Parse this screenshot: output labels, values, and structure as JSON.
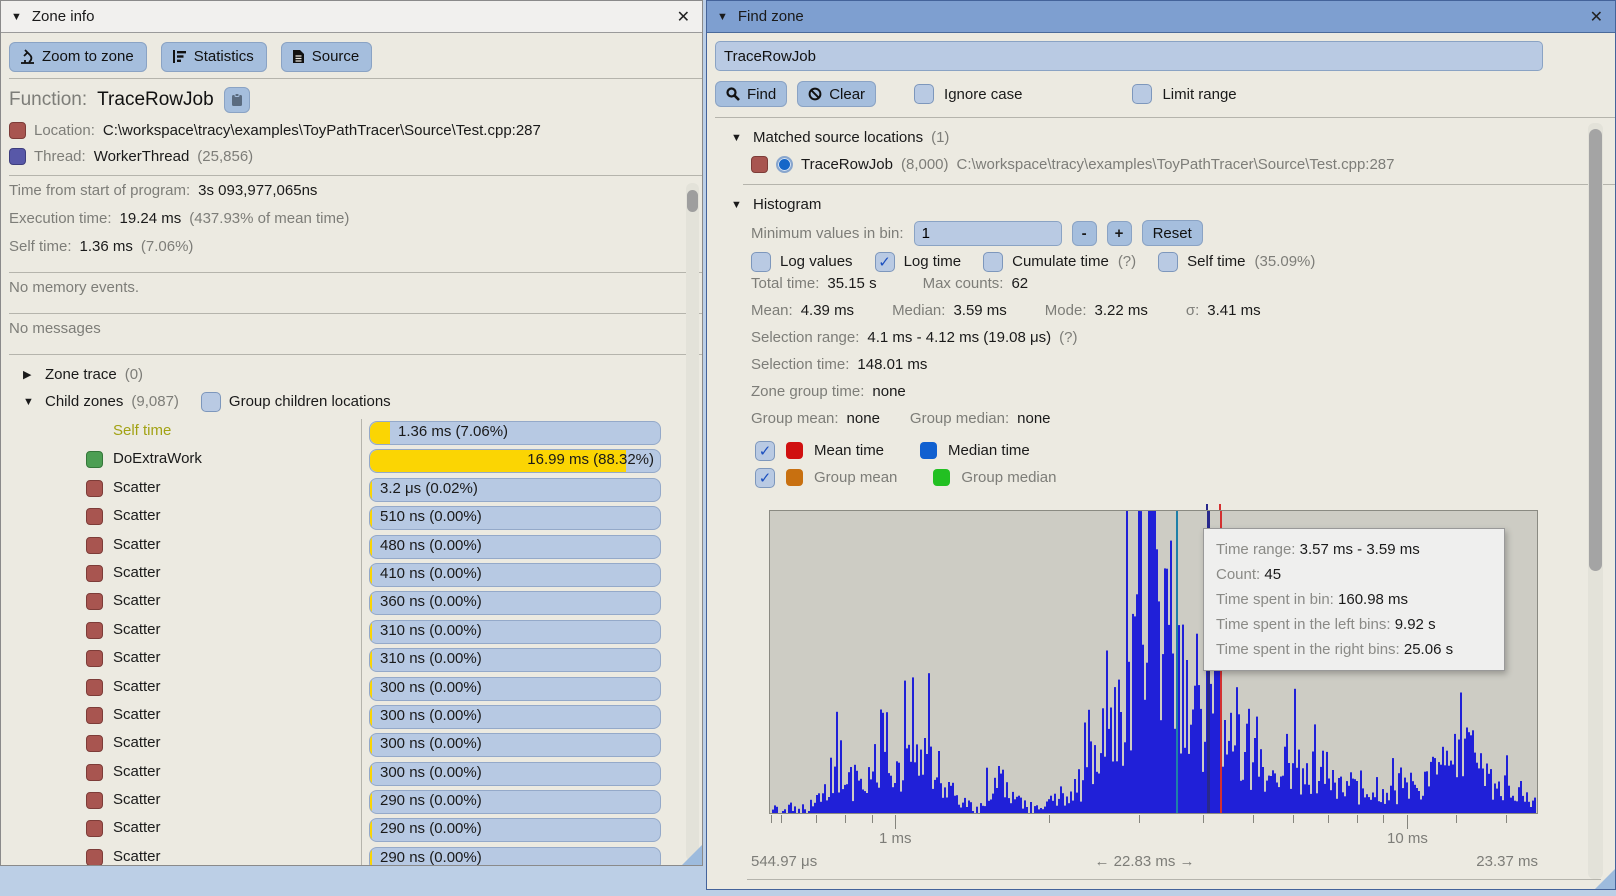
{
  "zone_info": {
    "title": "Zone info",
    "collapse_icon": "▼",
    "close_icon": "✕",
    "toolbar": {
      "zoom_label": "Zoom to zone",
      "stats_label": "Statistics",
      "source_label": "Source"
    },
    "function_label": "Function:",
    "function_name": "TraceRowJob",
    "location_label": "Location:",
    "location_path": "C:\\workspace\\tracy\\examples\\ToyPathTracer\\Source\\Test.cpp:287",
    "thread_label": "Thread:",
    "thread_name": "WorkerThread",
    "thread_id": "(25,856)",
    "time_from_start_label": "Time from start of program:",
    "time_from_start": "3s 093,977,065ns",
    "execution_time_label": "Execution time:",
    "execution_time": "19.24 ms",
    "execution_time_note": "(437.93% of mean time)",
    "self_time_label": "Self time:",
    "self_time": "1.36 ms",
    "self_time_note": "(7.06%)",
    "no_memory_events": "No memory events.",
    "no_messages": "No messages",
    "zone_trace_label": "Zone trace",
    "zone_trace_count": "(0)",
    "child_zones_label": "Child zones",
    "child_zones_count": "(9,087)",
    "group_children_label": "Group children locations",
    "child_rows": [
      {
        "swatch": "none",
        "name": "Self time",
        "value": "1.36 ms (7.06%)",
        "pct": 7.06
      },
      {
        "swatch": "green",
        "name": "DoExtraWork",
        "value": "16.99 ms (88.32%)",
        "pct": 88.32
      },
      {
        "swatch": "red",
        "name": "Scatter",
        "value": "3.2 μs (0.02%)",
        "pct": 0.7
      },
      {
        "swatch": "red",
        "name": "Scatter",
        "value": "510 ns (0.00%)",
        "pct": 0.7
      },
      {
        "swatch": "red",
        "name": "Scatter",
        "value": "480 ns (0.00%)",
        "pct": 0.7
      },
      {
        "swatch": "red",
        "name": "Scatter",
        "value": "410 ns (0.00%)",
        "pct": 0.7
      },
      {
        "swatch": "red",
        "name": "Scatter",
        "value": "360 ns (0.00%)",
        "pct": 0.7
      },
      {
        "swatch": "red",
        "name": "Scatter",
        "value": "310 ns (0.00%)",
        "pct": 0.7
      },
      {
        "swatch": "red",
        "name": "Scatter",
        "value": "310 ns (0.00%)",
        "pct": 0.7
      },
      {
        "swatch": "red",
        "name": "Scatter",
        "value": "300 ns (0.00%)",
        "pct": 0.7
      },
      {
        "swatch": "red",
        "name": "Scatter",
        "value": "300 ns (0.00%)",
        "pct": 0.7
      },
      {
        "swatch": "red",
        "name": "Scatter",
        "value": "300 ns (0.00%)",
        "pct": 0.7
      },
      {
        "swatch": "red",
        "name": "Scatter",
        "value": "300 ns (0.00%)",
        "pct": 0.7
      },
      {
        "swatch": "red",
        "name": "Scatter",
        "value": "290 ns (0.00%)",
        "pct": 0.7
      },
      {
        "swatch": "red",
        "name": "Scatter",
        "value": "290 ns (0.00%)",
        "pct": 0.7
      },
      {
        "swatch": "red",
        "name": "Scatter",
        "value": "290 ns (0.00%)",
        "pct": 0.7
      },
      {
        "swatch": "red",
        "name": "Scatter",
        "value": "290 ns (0.00%)",
        "pct": 0.7
      }
    ]
  },
  "find_zone": {
    "title": "Find zone",
    "collapse_icon": "▼",
    "close_icon": "✕",
    "search_value": "TraceRowJob",
    "find_label": "Find",
    "clear_label": "Clear",
    "ignore_case_label": "Ignore case",
    "limit_range_label": "Limit range",
    "matched_label": "Matched source locations",
    "matched_count": "(1)",
    "match": {
      "name": "TraceRowJob",
      "count": "(8,000)",
      "path": "C:\\workspace\\tracy\\examples\\ToyPathTracer\\Source\\Test.cpp:287"
    },
    "histogram_label": "Histogram",
    "min_values_label": "Minimum values in bin:",
    "min_values_value": "1",
    "minus_label": "-",
    "plus_label": "+",
    "reset_label": "Reset",
    "log_values_label": "Log values",
    "log_time_label": "Log time",
    "cumulate_label": "Cumulate time",
    "cumulate_help": "(?)",
    "self_time_label": "Self time",
    "self_time_note": "(35.09%)",
    "total_time_label": "Total time:",
    "total_time": "35.15 s",
    "max_counts_label": "Max counts:",
    "max_counts": "62",
    "mean_label": "Mean:",
    "mean": "4.39 ms",
    "median_label": "Median:",
    "median": "3.59 ms",
    "mode_label": "Mode:",
    "mode": "3.22 ms",
    "sigma_label": "σ:",
    "sigma": "3.41 ms",
    "selection_range_label": "Selection range:",
    "selection_range": "4.1 ms - 4.12 ms (19.08 μs)",
    "selection_range_help": "(?)",
    "selection_time_label": "Selection time:",
    "selection_time": "148.01 ms",
    "zone_group_time_label": "Zone group time:",
    "zone_group_time": "none",
    "group_mean_label": "Group mean:",
    "group_mean": "none",
    "group_median_label": "Group median:",
    "group_median": "none",
    "legend": {
      "mean_time": "Mean time",
      "median_time": "Median time",
      "group_mean": "Group mean",
      "group_median": "Group median"
    },
    "tooltip": {
      "time_range_label": "Time range:",
      "time_range": "3.57 ms - 3.59 ms",
      "count_label": "Count:",
      "count": "45",
      "bin_label": "Time spent in bin:",
      "bin": "160.98 ms",
      "left_label": "Time spent in the left bins:",
      "left": "9.92 s",
      "right_label": "Time spent in the right bins:",
      "right": "25.06 s"
    },
    "axis": {
      "major_labels": [
        "1 ms",
        "10 ms"
      ],
      "min_label": "544.97 μs",
      "center_label": "← 22.83 ms →",
      "max_label": "23.37 ms"
    },
    "chart_data": {
      "type": "bar",
      "title": "Zone execution time histogram (log time axis)",
      "x_min": "544.97 μs",
      "x_max": "23.37 ms",
      "y_max_counts": 62,
      "bar_color": "#2020d8",
      "mean_marker": {
        "value": "4.39 ms",
        "frac": 0.587,
        "color": "#d43030"
      },
      "median_marker": {
        "value": "3.59 ms",
        "frac": 0.529,
        "color": "#1e7fa8"
      },
      "selection_marker": {
        "value": "4.1 ms - 4.12 ms",
        "frac": 0.57,
        "color": "#28288c"
      },
      "envelope": [
        [
          0,
          0.02
        ],
        [
          0.05,
          0.03
        ],
        [
          0.07,
          0.1
        ],
        [
          0.085,
          0.3
        ],
        [
          0.1,
          0.12
        ],
        [
          0.13,
          0.2
        ],
        [
          0.155,
          0.32
        ],
        [
          0.175,
          0.22
        ],
        [
          0.19,
          0.3
        ],
        [
          0.21,
          0.26
        ],
        [
          0.225,
          0.12
        ],
        [
          0.25,
          0.05
        ],
        [
          0.27,
          0.02
        ],
        [
          0.3,
          0.17
        ],
        [
          0.315,
          0.06
        ],
        [
          0.34,
          0.03
        ],
        [
          0.37,
          0.06
        ],
        [
          0.4,
          0.12
        ],
        [
          0.42,
          0.2
        ],
        [
          0.44,
          0.35
        ],
        [
          0.46,
          0.55
        ],
        [
          0.47,
          0.75
        ],
        [
          0.48,
          1.0
        ],
        [
          0.49,
          0.9
        ],
        [
          0.5,
          0.95
        ],
        [
          0.51,
          0.8
        ],
        [
          0.52,
          0.85
        ],
        [
          0.53,
          0.7
        ],
        [
          0.55,
          0.6
        ],
        [
          0.57,
          0.5
        ],
        [
          0.59,
          0.45
        ],
        [
          0.61,
          0.35
        ],
        [
          0.63,
          0.28
        ],
        [
          0.65,
          0.22
        ],
        [
          0.67,
          0.25
        ],
        [
          0.69,
          0.18
        ],
        [
          0.71,
          0.22
        ],
        [
          0.73,
          0.16
        ],
        [
          0.75,
          0.12
        ],
        [
          0.77,
          0.1
        ],
        [
          0.79,
          0.08
        ],
        [
          0.81,
          0.1
        ],
        [
          0.83,
          0.15
        ],
        [
          0.85,
          0.12
        ],
        [
          0.87,
          0.18
        ],
        [
          0.89,
          0.22
        ],
        [
          0.905,
          0.3
        ],
        [
          0.92,
          0.18
        ],
        [
          0.94,
          0.14
        ],
        [
          0.96,
          0.16
        ],
        [
          0.98,
          0.08
        ],
        [
          1.0,
          0.03
        ]
      ],
      "ticks_minor": [
        2,
        12,
        47,
        76,
        103,
        280,
        370,
        434,
        484,
        524,
        559,
        588,
        614,
        687,
        737
      ],
      "ticks_major": [
        126,
        638
      ]
    }
  }
}
